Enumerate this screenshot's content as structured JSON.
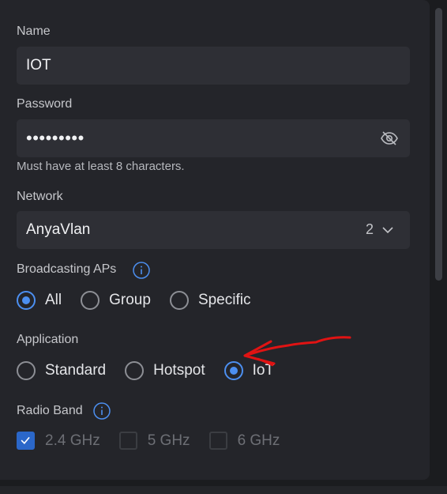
{
  "name": {
    "label": "Name",
    "value": "IOT"
  },
  "password": {
    "label": "Password",
    "masked_value": "•••••••••",
    "helper": "Must have at least 8 characters.",
    "toggle_icon": "eye-slash-icon"
  },
  "network": {
    "label": "Network",
    "value": "AnyaVlan",
    "count": "2",
    "icon": "chevron-down-icon"
  },
  "broadcasting": {
    "label": "Broadcasting APs",
    "info_icon": "info-icon",
    "options": [
      {
        "label": "All",
        "checked": true
      },
      {
        "label": "Group",
        "checked": false
      },
      {
        "label": "Specific",
        "checked": false
      }
    ]
  },
  "application": {
    "label": "Application",
    "options": [
      {
        "label": "Standard",
        "checked": false
      },
      {
        "label": "Hotspot",
        "checked": false
      },
      {
        "label": "IoT",
        "checked": true
      }
    ]
  },
  "radio_band": {
    "label": "Radio Band",
    "info_icon": "info-icon",
    "options": [
      {
        "label": "2.4 GHz",
        "checked": true
      },
      {
        "label": "5 GHz",
        "checked": false
      },
      {
        "label": "6 GHz",
        "checked": false
      }
    ]
  },
  "colors": {
    "accent": "#4c8ff0",
    "annotation": "#e01313",
    "panel": "#24252a",
    "field": "#2e2f35"
  }
}
